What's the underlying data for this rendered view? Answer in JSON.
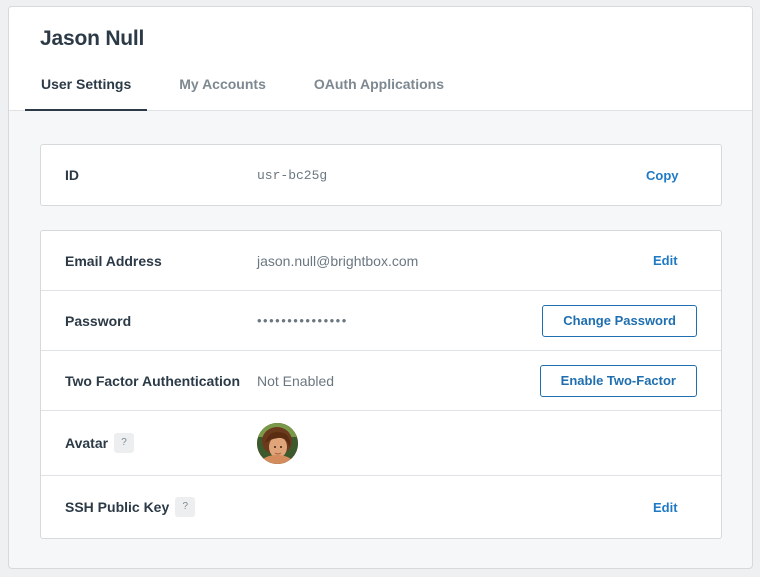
{
  "header": {
    "title": "Jason Null",
    "tabs": [
      {
        "label": "User Settings",
        "active": true
      },
      {
        "label": "My Accounts",
        "active": false
      },
      {
        "label": "OAuth Applications",
        "active": false
      }
    ]
  },
  "id_card": {
    "label": "ID",
    "value": "usr-bc25g",
    "action": "Copy"
  },
  "settings": {
    "email": {
      "label": "Email Address",
      "value": "jason.null@brightbox.com",
      "action": "Edit"
    },
    "password": {
      "label": "Password",
      "value": "•••••••••••••••",
      "action": "Change Password"
    },
    "two_factor": {
      "label": "Two Factor Authentication",
      "value": "Not Enabled",
      "action": "Enable Two-Factor"
    },
    "avatar": {
      "label": "Avatar",
      "help": "?"
    },
    "ssh": {
      "label": "SSH Public Key",
      "help": "?",
      "action": "Edit"
    }
  },
  "colors": {
    "accent": "#1f7ac4",
    "text": "#2b3a46",
    "muted": "#6b7780"
  }
}
